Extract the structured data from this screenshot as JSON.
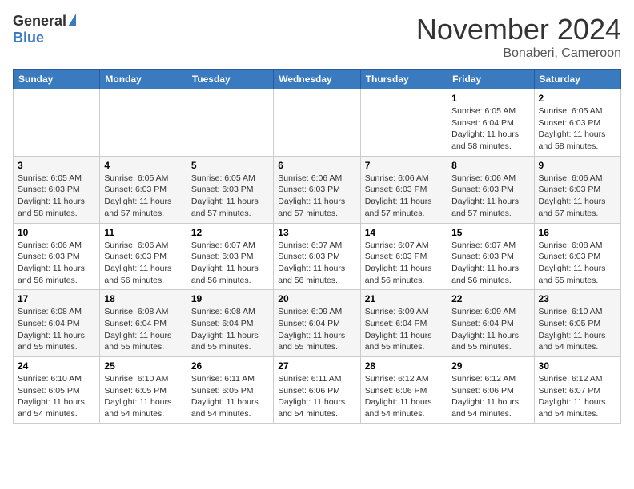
{
  "header": {
    "logo_general": "General",
    "logo_blue": "Blue",
    "month_year": "November 2024",
    "location": "Bonaberi, Cameroon"
  },
  "days_of_week": [
    "Sunday",
    "Monday",
    "Tuesday",
    "Wednesday",
    "Thursday",
    "Friday",
    "Saturday"
  ],
  "weeks": [
    [
      {
        "day": "",
        "info": ""
      },
      {
        "day": "",
        "info": ""
      },
      {
        "day": "",
        "info": ""
      },
      {
        "day": "",
        "info": ""
      },
      {
        "day": "",
        "info": ""
      },
      {
        "day": "1",
        "info": "Sunrise: 6:05 AM\nSunset: 6:04 PM\nDaylight: 11 hours and 58 minutes."
      },
      {
        "day": "2",
        "info": "Sunrise: 6:05 AM\nSunset: 6:03 PM\nDaylight: 11 hours and 58 minutes."
      }
    ],
    [
      {
        "day": "3",
        "info": "Sunrise: 6:05 AM\nSunset: 6:03 PM\nDaylight: 11 hours and 58 minutes."
      },
      {
        "day": "4",
        "info": "Sunrise: 6:05 AM\nSunset: 6:03 PM\nDaylight: 11 hours and 57 minutes."
      },
      {
        "day": "5",
        "info": "Sunrise: 6:05 AM\nSunset: 6:03 PM\nDaylight: 11 hours and 57 minutes."
      },
      {
        "day": "6",
        "info": "Sunrise: 6:06 AM\nSunset: 6:03 PM\nDaylight: 11 hours and 57 minutes."
      },
      {
        "day": "7",
        "info": "Sunrise: 6:06 AM\nSunset: 6:03 PM\nDaylight: 11 hours and 57 minutes."
      },
      {
        "day": "8",
        "info": "Sunrise: 6:06 AM\nSunset: 6:03 PM\nDaylight: 11 hours and 57 minutes."
      },
      {
        "day": "9",
        "info": "Sunrise: 6:06 AM\nSunset: 6:03 PM\nDaylight: 11 hours and 57 minutes."
      }
    ],
    [
      {
        "day": "10",
        "info": "Sunrise: 6:06 AM\nSunset: 6:03 PM\nDaylight: 11 hours and 56 minutes."
      },
      {
        "day": "11",
        "info": "Sunrise: 6:06 AM\nSunset: 6:03 PM\nDaylight: 11 hours and 56 minutes."
      },
      {
        "day": "12",
        "info": "Sunrise: 6:07 AM\nSunset: 6:03 PM\nDaylight: 11 hours and 56 minutes."
      },
      {
        "day": "13",
        "info": "Sunrise: 6:07 AM\nSunset: 6:03 PM\nDaylight: 11 hours and 56 minutes."
      },
      {
        "day": "14",
        "info": "Sunrise: 6:07 AM\nSunset: 6:03 PM\nDaylight: 11 hours and 56 minutes."
      },
      {
        "day": "15",
        "info": "Sunrise: 6:07 AM\nSunset: 6:03 PM\nDaylight: 11 hours and 56 minutes."
      },
      {
        "day": "16",
        "info": "Sunrise: 6:08 AM\nSunset: 6:03 PM\nDaylight: 11 hours and 55 minutes."
      }
    ],
    [
      {
        "day": "17",
        "info": "Sunrise: 6:08 AM\nSunset: 6:04 PM\nDaylight: 11 hours and 55 minutes."
      },
      {
        "day": "18",
        "info": "Sunrise: 6:08 AM\nSunset: 6:04 PM\nDaylight: 11 hours and 55 minutes."
      },
      {
        "day": "19",
        "info": "Sunrise: 6:08 AM\nSunset: 6:04 PM\nDaylight: 11 hours and 55 minutes."
      },
      {
        "day": "20",
        "info": "Sunrise: 6:09 AM\nSunset: 6:04 PM\nDaylight: 11 hours and 55 minutes."
      },
      {
        "day": "21",
        "info": "Sunrise: 6:09 AM\nSunset: 6:04 PM\nDaylight: 11 hours and 55 minutes."
      },
      {
        "day": "22",
        "info": "Sunrise: 6:09 AM\nSunset: 6:04 PM\nDaylight: 11 hours and 55 minutes."
      },
      {
        "day": "23",
        "info": "Sunrise: 6:10 AM\nSunset: 6:05 PM\nDaylight: 11 hours and 54 minutes."
      }
    ],
    [
      {
        "day": "24",
        "info": "Sunrise: 6:10 AM\nSunset: 6:05 PM\nDaylight: 11 hours and 54 minutes."
      },
      {
        "day": "25",
        "info": "Sunrise: 6:10 AM\nSunset: 6:05 PM\nDaylight: 11 hours and 54 minutes."
      },
      {
        "day": "26",
        "info": "Sunrise: 6:11 AM\nSunset: 6:05 PM\nDaylight: 11 hours and 54 minutes."
      },
      {
        "day": "27",
        "info": "Sunrise: 6:11 AM\nSunset: 6:06 PM\nDaylight: 11 hours and 54 minutes."
      },
      {
        "day": "28",
        "info": "Sunrise: 6:12 AM\nSunset: 6:06 PM\nDaylight: 11 hours and 54 minutes."
      },
      {
        "day": "29",
        "info": "Sunrise: 6:12 AM\nSunset: 6:06 PM\nDaylight: 11 hours and 54 minutes."
      },
      {
        "day": "30",
        "info": "Sunrise: 6:12 AM\nSunset: 6:07 PM\nDaylight: 11 hours and 54 minutes."
      }
    ]
  ]
}
